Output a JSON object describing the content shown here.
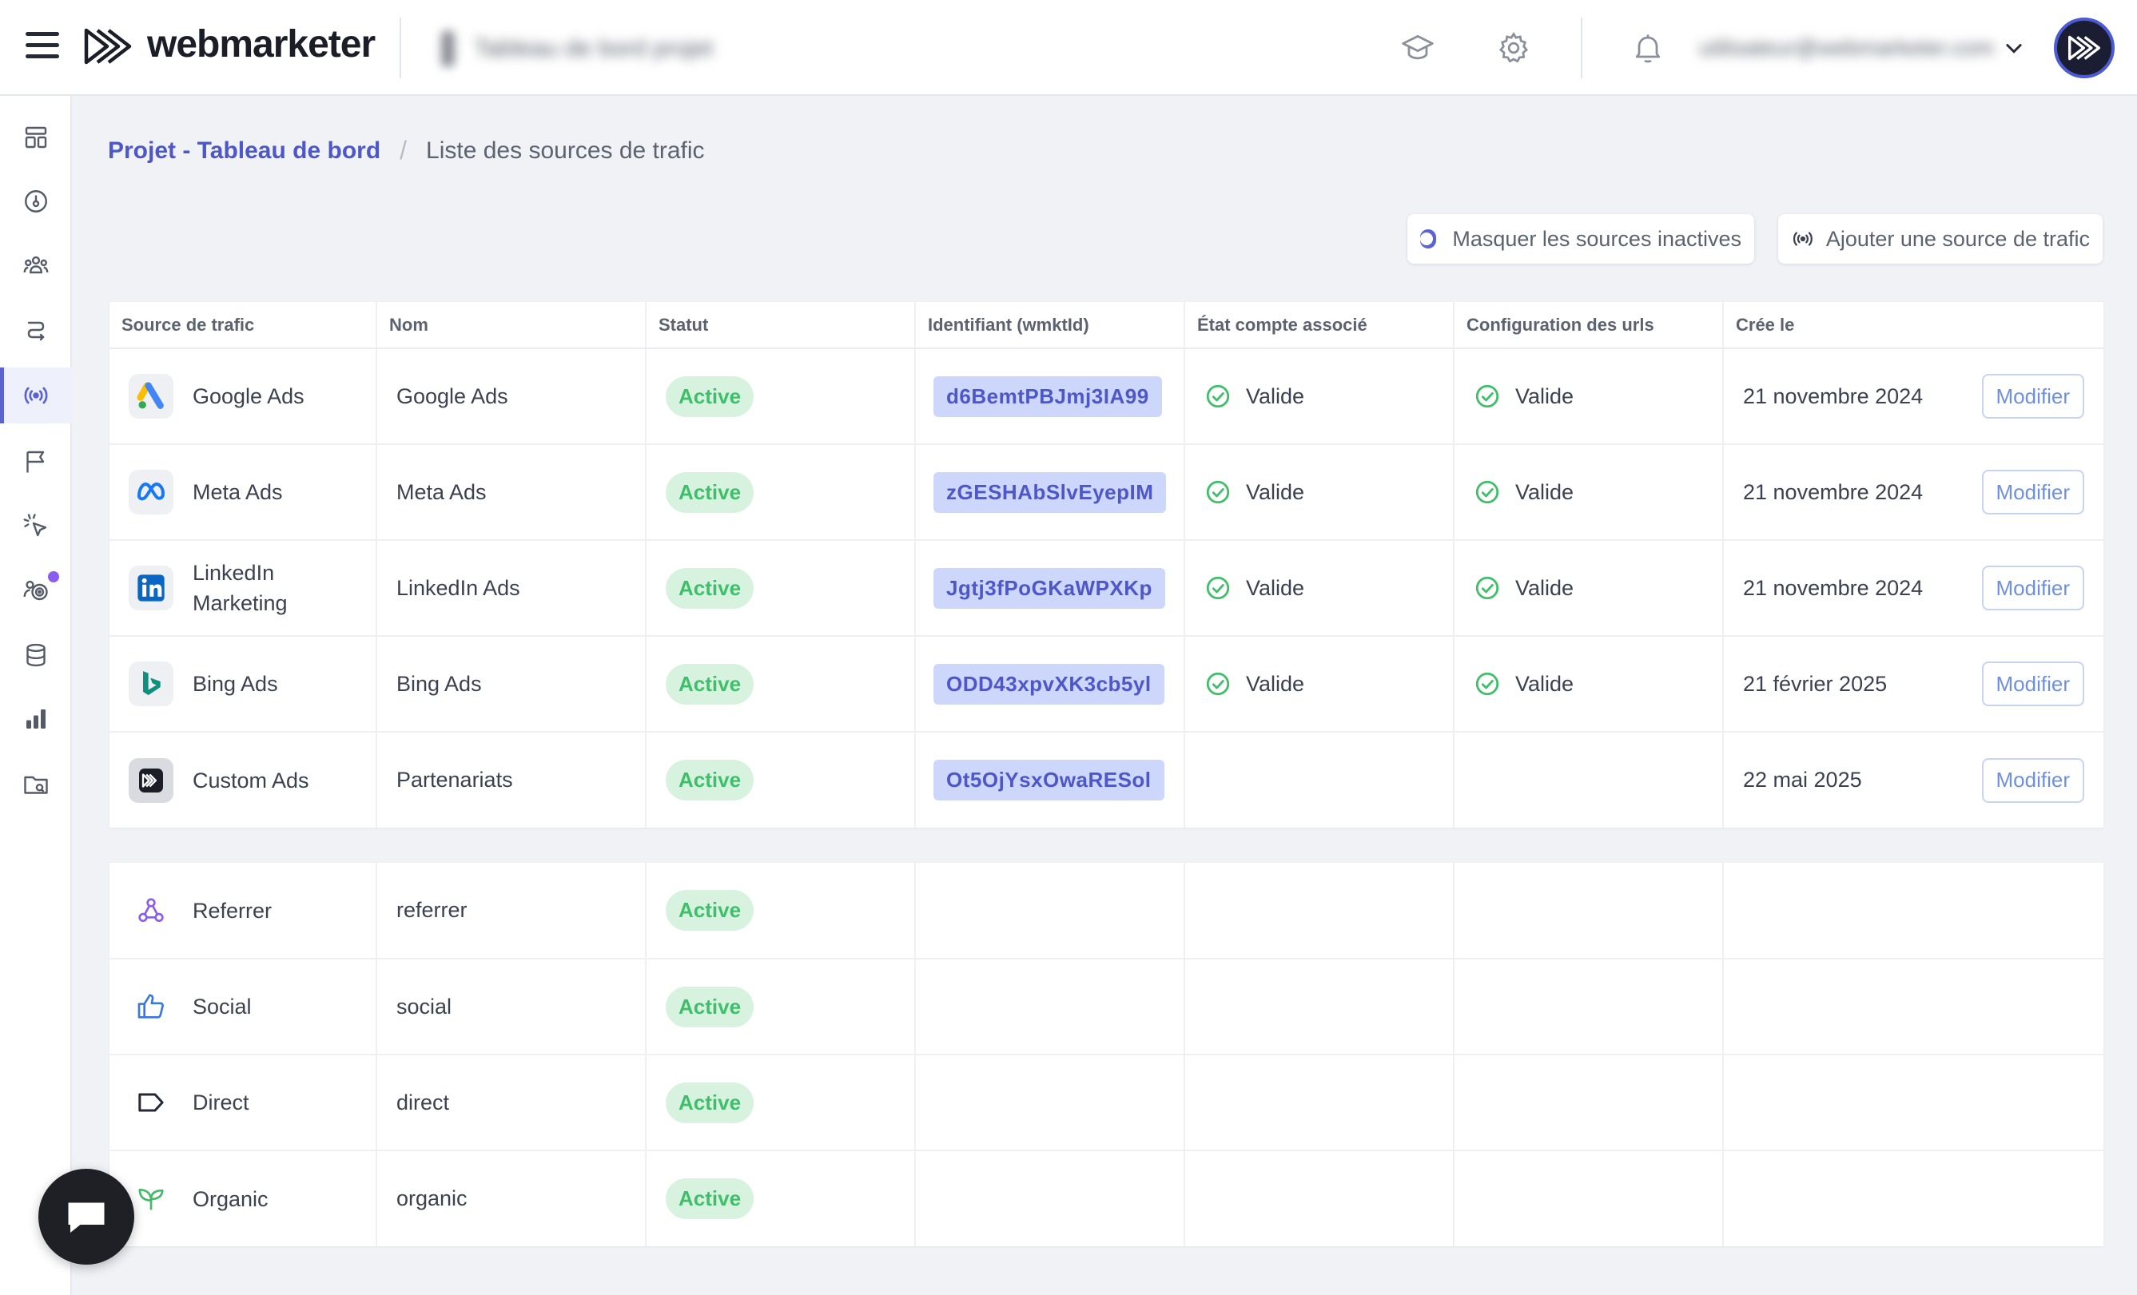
{
  "app": {
    "logo_text": "webmarketer",
    "project_name": "Tableau de bord projet",
    "user_email": "utilisateur@webmarketer.com"
  },
  "breadcrumb": {
    "parent": "Projet - Tableau de bord",
    "current": "Liste des sources de trafic"
  },
  "actions": {
    "hide_inactive_label": "Masquer les sources inactives",
    "hide_inactive_on": true,
    "add_source_label": "Ajouter une source de trafic"
  },
  "table": {
    "headers": [
      "Source de trafic",
      "Nom",
      "Statut",
      "Identifiant (wmktId)",
      "État compte associé",
      "Configuration des urls",
      "Crée le"
    ],
    "rows": [
      {
        "source": "Google Ads",
        "icon": "google-ads-icon",
        "name": "Google Ads",
        "status": "Active",
        "id": "d6BemtPBJmj3IA99",
        "account": "Valide",
        "urls": "Valide",
        "created": "21 novembre 2024",
        "action": "Modifier"
      },
      {
        "source": "Meta Ads",
        "icon": "meta-icon",
        "name": "Meta Ads",
        "status": "Active",
        "id": "zGESHAbSlvEyepIM",
        "account": "Valide",
        "urls": "Valide",
        "created": "21 novembre 2024",
        "action": "Modifier"
      },
      {
        "source": "LinkedIn Marketing",
        "icon": "linkedin-icon",
        "name": "LinkedIn Ads",
        "status": "Active",
        "id": "Jgtj3fPoGKaWPXKp",
        "account": "Valide",
        "urls": "Valide",
        "created": "21 novembre 2024",
        "action": "Modifier"
      },
      {
        "source": "Bing Ads",
        "icon": "bing-icon",
        "name": "Bing Ads",
        "status": "Active",
        "id": "ODD43xpvXK3cb5yl",
        "account": "Valide",
        "urls": "Valide",
        "created": "21 février 2025",
        "action": "Modifier"
      },
      {
        "source": "Custom Ads",
        "icon": "custom-ads-icon",
        "name": "Partenariats",
        "status": "Active",
        "id": "Ot5OjYsxOwaRESol",
        "account": "",
        "urls": "",
        "created": "22 mai 2025",
        "action": "Modifier"
      }
    ]
  },
  "organic_table": {
    "rows": [
      {
        "source": "Referrer",
        "icon": "referrer-icon",
        "name": "referrer",
        "status": "Active"
      },
      {
        "source": "Social",
        "icon": "thumbs-up-icon",
        "name": "social",
        "status": "Active"
      },
      {
        "source": "Direct",
        "icon": "tag-icon",
        "name": "direct",
        "status": "Active"
      },
      {
        "source": "Organic",
        "icon": "sprout-icon",
        "name": "organic",
        "status": "Active"
      }
    ]
  },
  "sidebar": {
    "items": [
      {
        "icon": "dashboard-icon"
      },
      {
        "icon": "gauge-icon"
      },
      {
        "icon": "users-icon"
      },
      {
        "icon": "route-icon"
      },
      {
        "icon": "broadcast-icon",
        "active": true
      },
      {
        "icon": "flag-icon"
      },
      {
        "icon": "click-icon"
      },
      {
        "icon": "targeting-icon",
        "dot": true
      },
      {
        "icon": "database-icon"
      },
      {
        "icon": "bar-chart-icon"
      },
      {
        "icon": "folder-icon"
      }
    ]
  },
  "colors": {
    "accent": "#5b63d3",
    "active_badge_bg": "#d7f3e0",
    "active_badge_text": "#3fbf6a",
    "id_badge_bg": "#cdd6fb",
    "valid_green": "#3fbf6a"
  }
}
